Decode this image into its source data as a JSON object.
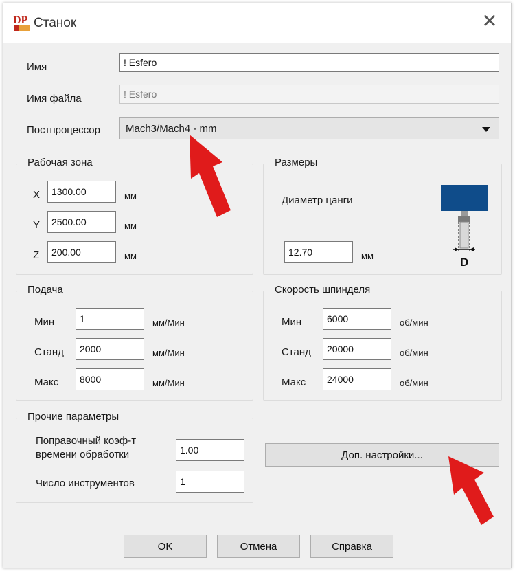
{
  "window": {
    "title": "Станок",
    "close_symbol": "✕",
    "app_logo_text": "DP"
  },
  "general": {
    "name_label": "Имя",
    "name_value": "! Esfero",
    "filename_label": "Имя файла",
    "filename_value": "! Esfero",
    "postprocessor_label": "Постпроцессор",
    "postprocessor_value": "Mach3/Mach4 - mm"
  },
  "work_area": {
    "title": "Рабочая зона",
    "x_label": "X",
    "x_value": "1300.00",
    "x_unit": "мм",
    "y_label": "Y",
    "y_value": "2500.00",
    "y_unit": "мм",
    "z_label": "Z",
    "z_value": "200.00",
    "z_unit": "мм"
  },
  "sizes": {
    "title": "Размеры",
    "collet_label": "Диаметр цанги",
    "collet_value": "12.70",
    "collet_unit": "мм",
    "diagram_label": "D"
  },
  "feed": {
    "title": "Подача",
    "min_label": "Мин",
    "min_value": "1",
    "min_unit": "мм/Мин",
    "std_label": "Станд",
    "std_value": "2000",
    "std_unit": "мм/Мин",
    "max_label": "Макс",
    "max_value": "8000",
    "max_unit": "мм/Мин"
  },
  "spindle": {
    "title": "Скорость шпинделя",
    "min_label": "Мин",
    "min_value": "6000",
    "min_unit": "об/мин",
    "std_label": "Станд",
    "std_value": "20000",
    "std_unit": "об/мин",
    "max_label": "Макс",
    "max_value": "24000",
    "max_unit": "об/мин"
  },
  "other": {
    "title": "Прочие параметры",
    "time_factor_label_line1": "Поправочный коэф-т",
    "time_factor_label_line2": "времени обработки",
    "time_factor_value": "1.00",
    "tool_count_label": "Число инструментов",
    "tool_count_value": "1"
  },
  "buttons": {
    "advanced": "Доп. настройки...",
    "ok": "OK",
    "cancel": "Отмена",
    "help": "Справка"
  },
  "colors": {
    "arrow": "#e01b1b",
    "collet_body": "#0f4c8a"
  }
}
